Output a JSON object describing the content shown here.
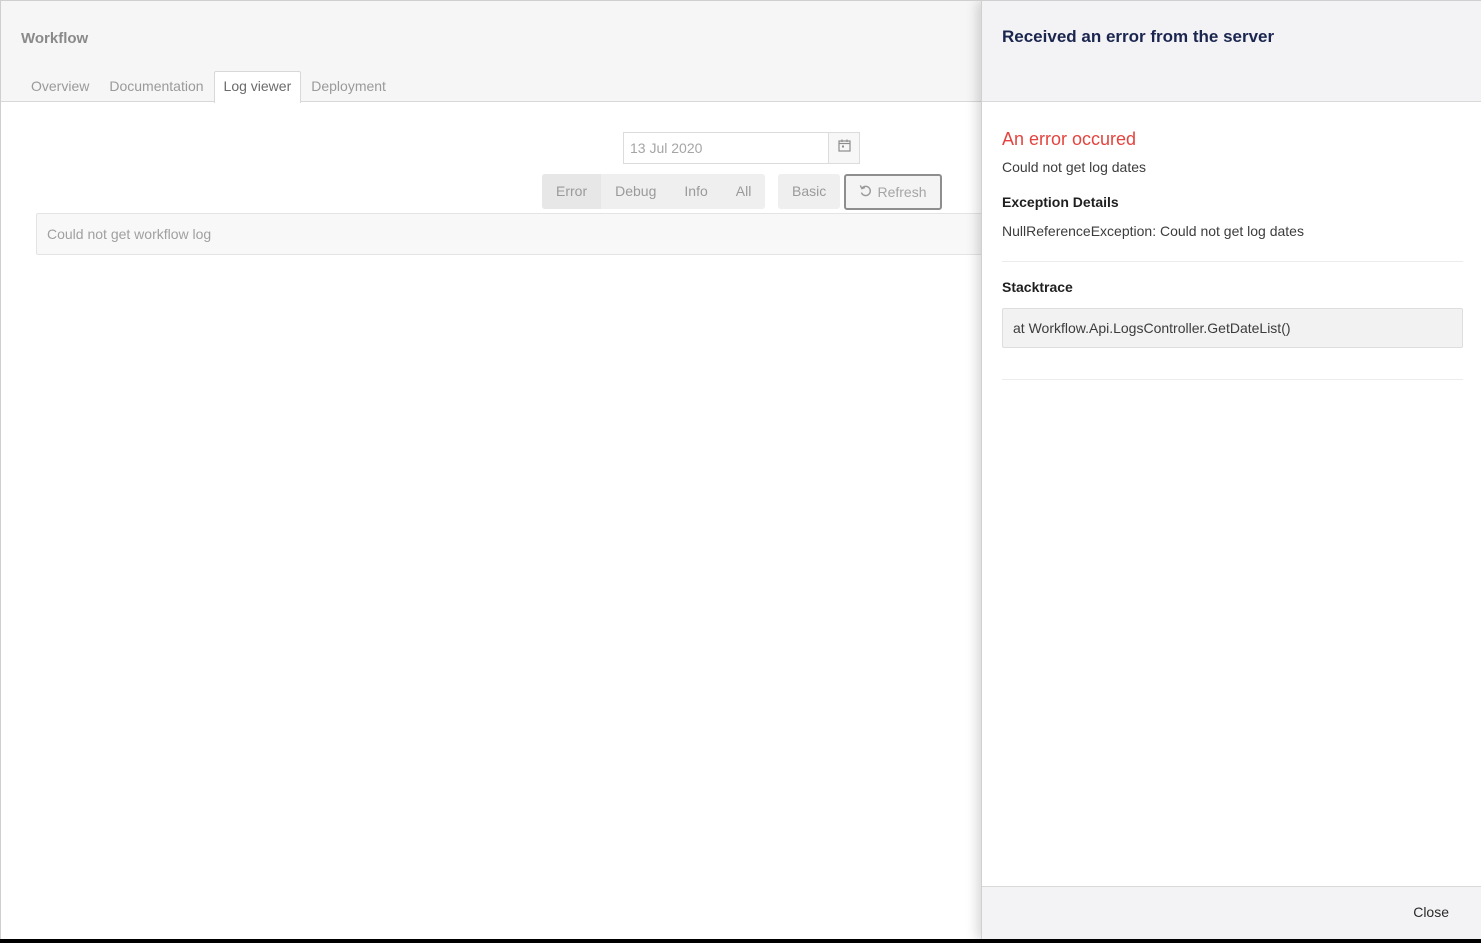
{
  "editor": {
    "title": "Workflow",
    "tabs": [
      {
        "label": "Overview",
        "active": false
      },
      {
        "label": "Documentation",
        "active": false
      },
      {
        "label": "Log viewer",
        "active": true
      },
      {
        "label": "Deployment",
        "active": false
      }
    ]
  },
  "log_viewer": {
    "date_value": "13 Jul 2020",
    "date_icon": "calendar-icon",
    "levels": [
      "Error",
      "Debug",
      "Info",
      "All"
    ],
    "active_level": "Error",
    "basic_label": "Basic",
    "refresh_label": "Refresh",
    "refresh_icon": "refresh-icon",
    "log_message": "Could not get workflow log"
  },
  "error_panel": {
    "title": "Received an error from the server",
    "heading": "An error occured",
    "message": "Could not get log dates",
    "exception_label": "Exception Details",
    "exception_text": "NullReferenceException: Could not get log dates",
    "stacktrace_label": "Stacktrace",
    "stacktrace": "at Workflow.Api.LogsController.GetDateList()",
    "close_label": "Close"
  },
  "colors": {
    "error_heading": "#e3443f",
    "panel_title": "#1b264f",
    "header_bg": "#f6f6f6"
  }
}
